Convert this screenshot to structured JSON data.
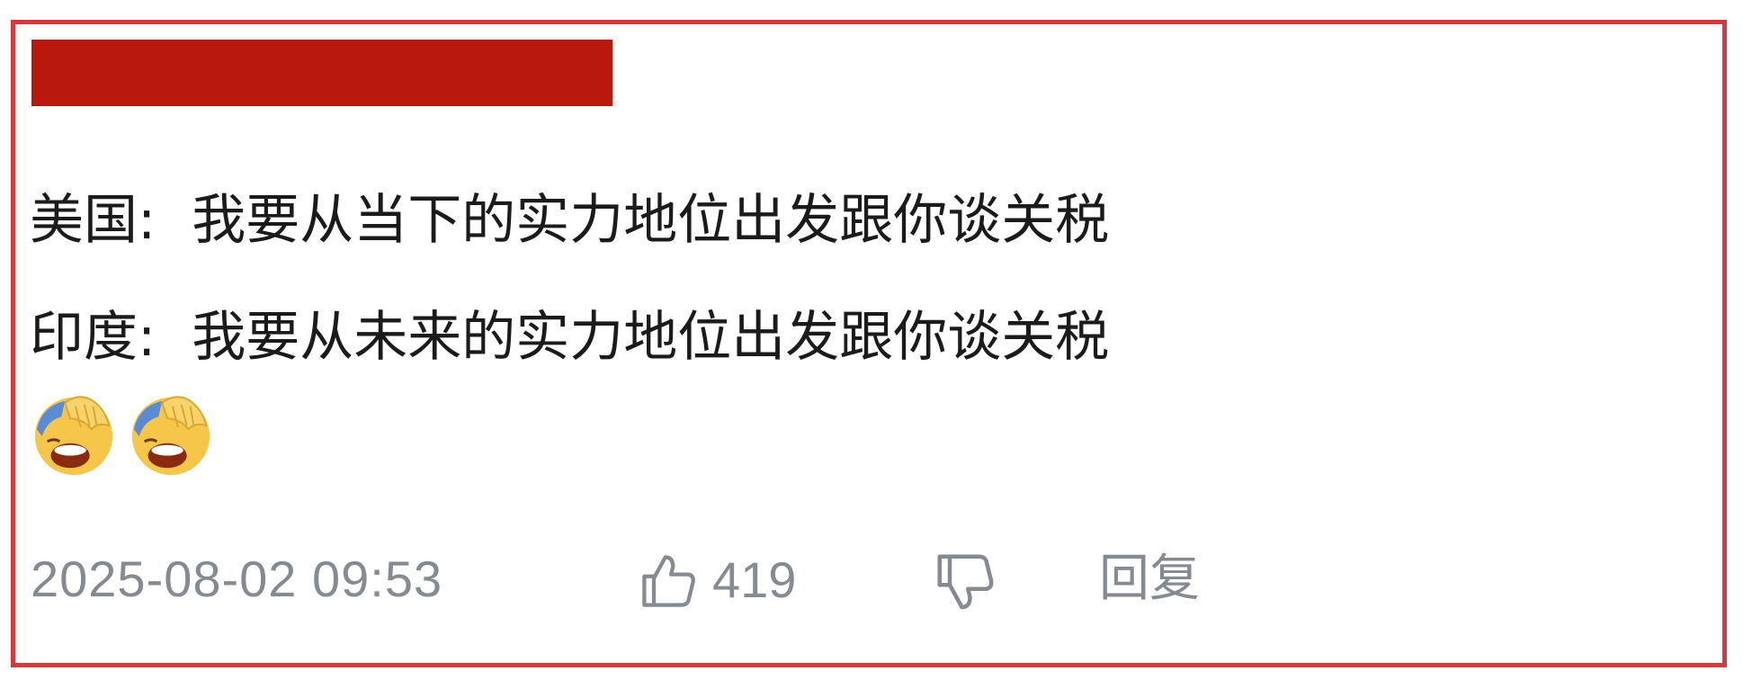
{
  "comment": {
    "lines": [
      {
        "speaker": "美国:",
        "text": "我要从当下的实力地位出发跟你谈关税"
      },
      {
        "speaker": "印度:",
        "text": "我要从未来的实力地位出发跟你谈关税"
      }
    ],
    "emojis": [
      "facepalm-laugh-emoji",
      "facepalm-laugh-emoji"
    ]
  },
  "meta": {
    "timestamp": "2025-08-02 09:53",
    "like_count": "419",
    "reply_label": "回复"
  },
  "colors": {
    "frame_border": "#d33a3c",
    "redaction": "#b8190c",
    "text": "#1b1b1b",
    "meta_text": "#868a91"
  }
}
